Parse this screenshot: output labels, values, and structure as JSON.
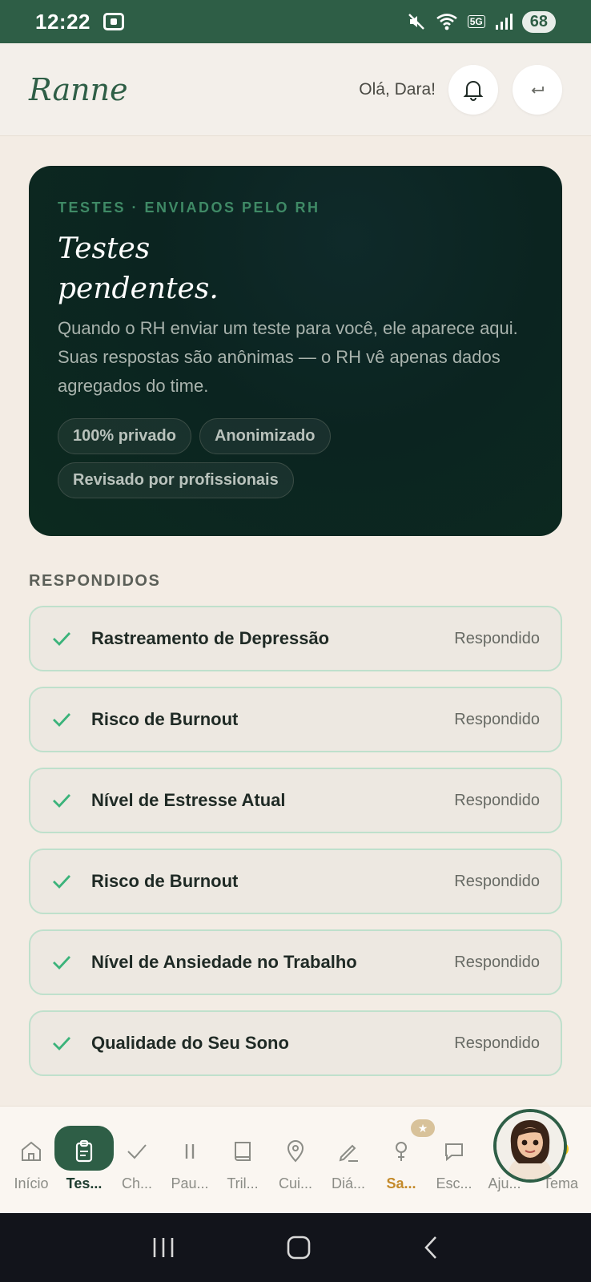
{
  "status_bar": {
    "time": "12:22",
    "battery": "68",
    "network": "5G"
  },
  "header": {
    "brand": "Ranne",
    "greeting": "Olá, Dara!"
  },
  "hero": {
    "eyebrow": "TESTES · ENVIADOS PELO RH",
    "title": "Testes pendentes.",
    "description": "Quando o RH enviar um teste para você, ele aparece aqui. Suas respostas são anônimas — o RH vê apenas dados agregados do time.",
    "chips": [
      "100% privado",
      "Anonimizado",
      "Revisado por profissionais"
    ]
  },
  "answered": {
    "section_label": "RESPONDIDOS",
    "items": [
      {
        "name": "Rastreamento de Depressão",
        "status": "Respondido"
      },
      {
        "name": "Risco de Burnout",
        "status": "Respondido"
      },
      {
        "name": "Nível de Estresse Atual",
        "status": "Respondido"
      },
      {
        "name": "Risco de Burnout",
        "status": "Respondido"
      },
      {
        "name": "Nível de Ansiedade no Trabalho",
        "status": "Respondido"
      },
      {
        "name": "Qualidade do Seu Sono",
        "status": "Respondido"
      }
    ]
  },
  "bottom_nav": {
    "items": [
      {
        "label": "Início",
        "icon": "home-icon"
      },
      {
        "label": "Tes...",
        "icon": "clipboard-icon",
        "active": true
      },
      {
        "label": "Ch...",
        "icon": "check-icon"
      },
      {
        "label": "Pau...",
        "icon": "pause-icon"
      },
      {
        "label": "Tril...",
        "icon": "book-icon"
      },
      {
        "label": "Cui...",
        "icon": "map-pin-icon"
      },
      {
        "label": "Diá...",
        "icon": "pen-icon"
      },
      {
        "label": "Sa...",
        "icon": "female-symbol-icon",
        "highlight": true,
        "badge": "★"
      },
      {
        "label": "Esc...",
        "icon": "chat-icon"
      },
      {
        "label": "Aju...",
        "icon": "help-icon"
      },
      {
        "label": "Tema",
        "icon": "theme-icon"
      }
    ]
  },
  "colors": {
    "brand_green": "#2e5e46",
    "hero_bg": "#0c2a1f",
    "accent_green": "#3f8a66",
    "highlight_gold": "#c48a2a",
    "background": "#f3ece4"
  }
}
